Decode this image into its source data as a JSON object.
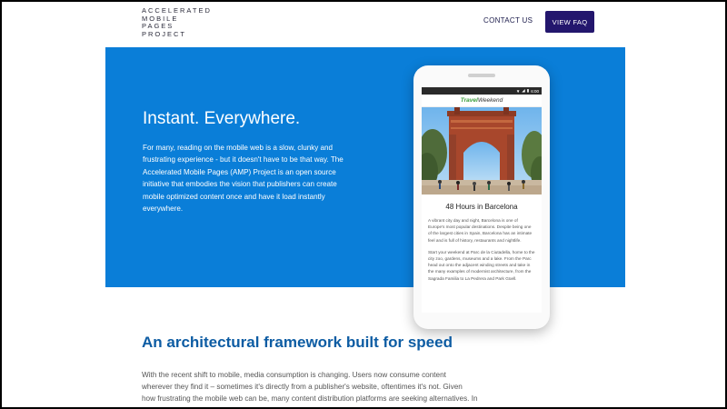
{
  "header": {
    "logo_lines": [
      "ACCELERATED",
      "MOBILE",
      "PAGES",
      "PROJECT"
    ],
    "contact_label": "CONTACT US",
    "faq_label": "VIEW FAQ"
  },
  "hero": {
    "title": "Instant. Everywhere.",
    "text": "For many, reading on the mobile web is a slow, clunky and frustrating experience - but it doesn't have to be that way. The Accelerated Mobile Pages (AMP) Project is an open source initiative that embodies the vision that publishers can create mobile optimized content once and have it load instantly everywhere."
  },
  "phone": {
    "status_time": "6:00",
    "site_brand_1": "Travel",
    "site_brand_2": "Weekend",
    "article_title": "48 Hours in Barcelona",
    "para1": "A vibrant city day and night, Barcelona is one of Europe's most popular destinations. Despite being one of the largest cities in Spain, Barcelona has an intimate feel and is full of history, restaurants and nightlife.",
    "para2": "Start your weekend at Parc de la Ciutadella, home to the city zoo, gardens, museums and a lake. From the Parc head out onto the adjacent winding streets and take in the many examples of modernist architecture, from the Sagrada Familia to La Pedrera and Park Güell."
  },
  "section": {
    "title": "An architectural framework built for speed",
    "text": "With the recent shift to mobile, media consumption is changing. Users now consume content wherever they find it – sometimes it's directly from a publisher's website, oftentimes it's not. Given how frustrating the mobile web can be, many content distribution platforms are seeking alternatives. In many cases, these alternatives tend to be platform specific, placing a burden on the publishers to"
  },
  "colors": {
    "hero_blue": "#0a7ed8",
    "button_purple": "#23166d",
    "section_title": "#0d5ca3"
  },
  "icons": [
    "signal-icon",
    "wifi-icon",
    "battery-icon"
  ]
}
